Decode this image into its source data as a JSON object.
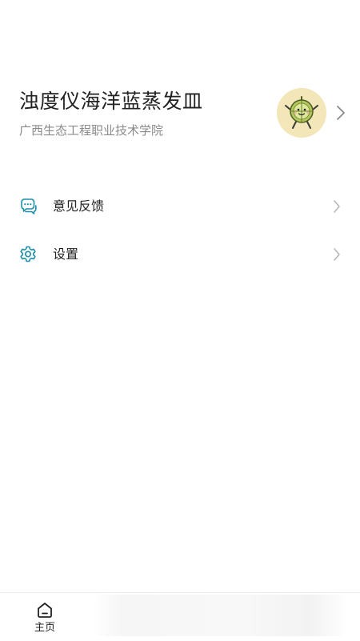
{
  "profile": {
    "name": "浊度仪海洋蓝蒸发皿",
    "school": "广西生态工程职业技术学院",
    "avatar_icon": "cartoon-melon-avatar"
  },
  "menu": {
    "items": [
      {
        "label": "意见反馈",
        "icon": "feedback-chat-icon"
      },
      {
        "label": "设置",
        "icon": "gear-icon"
      }
    ]
  },
  "tabbar": {
    "home_label": "主页",
    "home_icon": "home-icon"
  },
  "colors": {
    "accent": "#1e8fa8",
    "avatar_bg": "#f3e7b9",
    "secondary_text": "#8a8a8a",
    "chevron": "#b8b8b8"
  }
}
